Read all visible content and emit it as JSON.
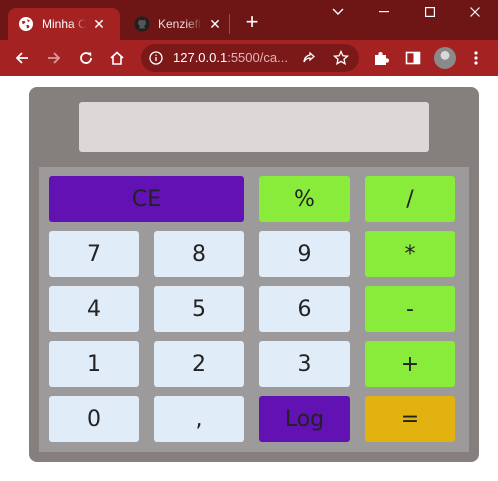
{
  "browser": {
    "tabs": [
      {
        "title": "Minha Calculadora",
        "icon": "globe-icon",
        "active": true
      },
      {
        "title": "Kenzieflix",
        "icon": "github-icon",
        "active": false
      }
    ],
    "new_tab_symbol": "+",
    "close_symbol": "✕",
    "url_host": "127.0.0.1",
    "url_rest": ":5500/ca...",
    "accent_color": "#a52222",
    "tabbar_color": "#6e1515"
  },
  "calculator": {
    "display_value": "",
    "keys": {
      "clear": "CE",
      "percent": "%",
      "divide": "/",
      "multiply": "*",
      "subtract": "-",
      "add": "+",
      "equals": "=",
      "log": "Log",
      "comma": ",",
      "d0": "0",
      "d1": "1",
      "d2": "2",
      "d3": "3",
      "d4": "4",
      "d5": "5",
      "d6": "6",
      "d7": "7",
      "d8": "8",
      "d9": "9"
    },
    "colors": {
      "body": "#857f7e",
      "keypad": "#9c9a9a",
      "display": "#dcd8d8",
      "number_key": "#e0ecf7",
      "operator_key": "#89ec3a",
      "function_key": "#6211b3",
      "equals_key": "#e2b211"
    }
  }
}
